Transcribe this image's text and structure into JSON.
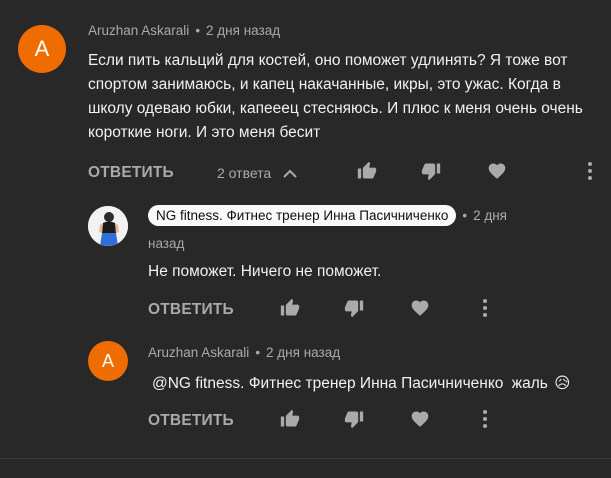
{
  "comment": {
    "avatar_letter": "A",
    "author": "Aruzhan Askarali",
    "separator": "•",
    "time": "2 дня назад",
    "text": "Если пить кальций для костей, оно поможет удлинять? Я тоже вот спортом занимаюсь, и капец накачанные, икры, это ужас. Когда в школу одеваю юбки, капееец стесняюсь. И плюс к меня очень очень короткие ноги. И это меня бесит",
    "reply_label": "ОТВЕТИТЬ",
    "replies_count": "2 ответа"
  },
  "replies": [
    {
      "author": "NG fitness. Фитнес тренер Инна Пасичниченко",
      "separator": "•",
      "time_part1": "2 дня",
      "time_part2": "назад",
      "text": "Не поможет. Ничего не поможет.",
      "reply_label": "ОТВЕТИТЬ"
    },
    {
      "avatar_letter": "A",
      "author": "Aruzhan Askarali",
      "separator": "•",
      "time": "2 дня назад",
      "mention": "@NG fitness. Фитнес тренер Инна Пасичниченко",
      "text_rest": "жаль",
      "emoji": "😥",
      "reply_label": "ОТВЕТИТЬ"
    }
  ],
  "colors": {
    "background": "#282828",
    "avatar": "#ef6c00",
    "text_primary": "#f1f1f1",
    "text_secondary": "#aaaaaa",
    "chip_bg": "#f9f9f9"
  },
  "icons": [
    "chevron-up-icon",
    "thumbs-up-icon",
    "thumbs-down-icon",
    "heart-icon",
    "more-vertical-icon"
  ]
}
